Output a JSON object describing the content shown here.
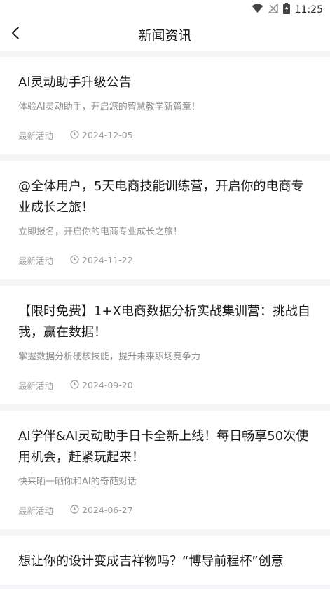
{
  "status": {
    "time": "11:25"
  },
  "nav": {
    "title": "新闻资讯"
  },
  "news": [
    {
      "title": "AI灵动助手升级公告",
      "desc": "体验AI灵动助手，开启您的智慧教学新篇章！",
      "category": "最新活动",
      "date": "2024-12-05"
    },
    {
      "title": "@全体用户，5天电商技能训练营，开启你的电商专业成长之旅！",
      "desc": "立即报名，开启你的电商专业成长之旅！",
      "category": "最新活动",
      "date": "2024-11-22"
    },
    {
      "title": "【限时免费】1+X电商数据分析实战集训营：挑战自我，赢在数据！",
      "desc": "掌握数据分析硬核技能，提升未来职场竞争力",
      "category": "最新活动",
      "date": "2024-09-20"
    },
    {
      "title": "AI学伴&AI灵动助手日卡全新上线！每日畅享50次使用机会，赶紧玩起来！",
      "desc": "快来晒一晒你和AI的奇葩对话",
      "category": "最新活动",
      "date": "2024-06-27"
    },
    {
      "title": "想让你的设计变成吉祥物吗？“博导前程杯”创意"
    }
  ]
}
